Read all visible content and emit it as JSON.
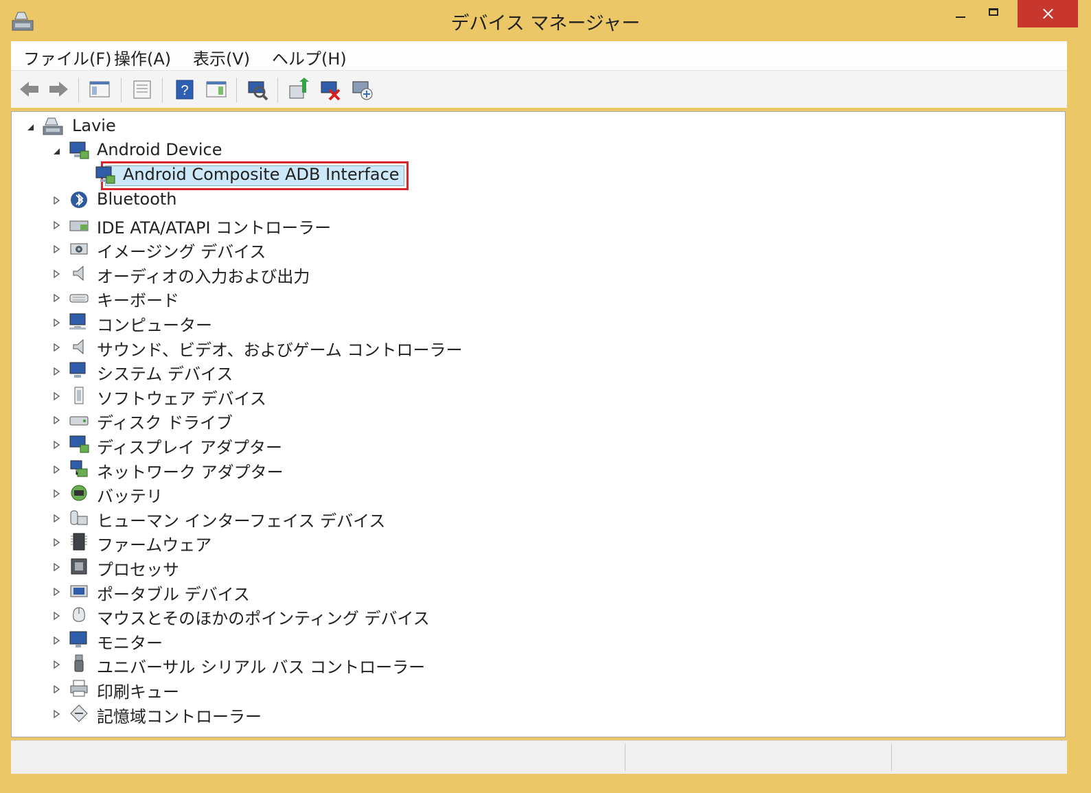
{
  "window": {
    "title": "デバイス マネージャー"
  },
  "menu": [
    "ファイル(F)",
    "操作(A)",
    "表示(V)",
    "ヘルプ(H)"
  ],
  "toolbar": [
    "back-icon",
    "forward-icon",
    "show-hide-console-tree-icon",
    "properties-icon",
    "help-icon",
    "action-pane-icon",
    "scan-hardware-icon",
    "update-driver-icon",
    "disable-device-icon",
    "enable-device-icon"
  ],
  "tree": {
    "root": "Lavie",
    "android_group": "Android Device",
    "android_child": "Android Composite ADB Interface",
    "categories": [
      "Bluetooth",
      "IDE ATA/ATAPI コントローラー",
      "イメージング デバイス",
      "オーディオの入力および出力",
      "キーボード",
      "コンピューター",
      "サウンド、ビデオ、およびゲーム コントローラー",
      "システム デバイス",
      "ソフトウェア デバイス",
      "ディスク ドライブ",
      "ディスプレイ アダプター",
      "ネットワーク アダプター",
      "バッテリ",
      "ヒューマン インターフェイス デバイス",
      "ファームウェア",
      "プロセッサ",
      "ポータブル デバイス",
      "マウスとそのほかのポインティング デバイス",
      "モニター",
      "ユニバーサル シリアル バス コントローラー",
      "印刷キュー",
      "記憶域コントローラー"
    ]
  },
  "colors": {
    "frame": "#ecc767",
    "close": "#c8372e",
    "highlight": "#d9262e"
  }
}
